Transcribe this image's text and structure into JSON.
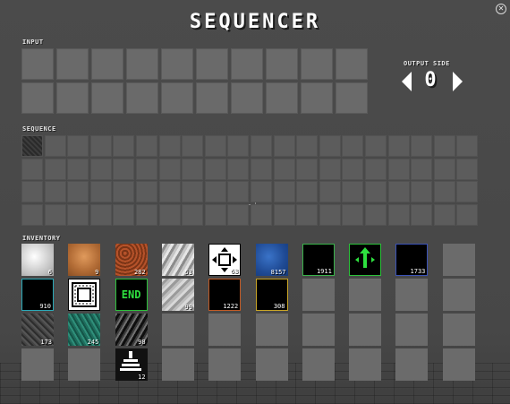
{
  "title": "SEQUENCER",
  "sections": {
    "input": "INPUT",
    "sequence": "SEQUENCE",
    "inventory": "INVENTORY"
  },
  "output_side": {
    "label": "OUTPUT SIDE",
    "value": "0"
  },
  "close_icon": "close-icon",
  "inventory_items": [
    {
      "name": "quartz-block",
      "count": "6",
      "style": "quartz"
    },
    {
      "name": "copper-block",
      "count": "9",
      "style": "copper"
    },
    {
      "name": "rusty-block",
      "count": "282",
      "style": "rust"
    },
    {
      "name": "gravel-block",
      "count": "53",
      "style": "gravel"
    },
    {
      "name": "spread-block",
      "count": "63",
      "style": "spread"
    },
    {
      "name": "water-block",
      "count": "8157",
      "style": "water"
    },
    {
      "name": "green-frame-block",
      "count": "1911",
      "style": "green-frame"
    },
    {
      "name": "direction-block",
      "count": "",
      "style": "direction"
    },
    {
      "name": "blue-frame-block",
      "count": "1733",
      "style": "blue-frame"
    },
    {
      "name": "cyan-frame-block",
      "count": "910",
      "style": "cyan-frame"
    },
    {
      "name": "chip-block",
      "count": "",
      "style": "chip"
    },
    {
      "name": "end-block",
      "count": "",
      "style": "end"
    },
    {
      "name": "stone-block",
      "count": "99",
      "style": "stone"
    },
    {
      "name": "orange-frame-block",
      "count": "1222",
      "style": "orange-frame"
    },
    {
      "name": "yellow-frame-block",
      "count": "308",
      "style": "yellow-frame"
    },
    {
      "name": "dark-stone-block",
      "count": "173",
      "style": "dark"
    },
    {
      "name": "teal-block",
      "count": "245",
      "style": "teal"
    },
    {
      "name": "coal-block",
      "count": "98",
      "style": "coal"
    },
    {
      "name": "stack-block",
      "count": "12",
      "style": "stack"
    }
  ]
}
